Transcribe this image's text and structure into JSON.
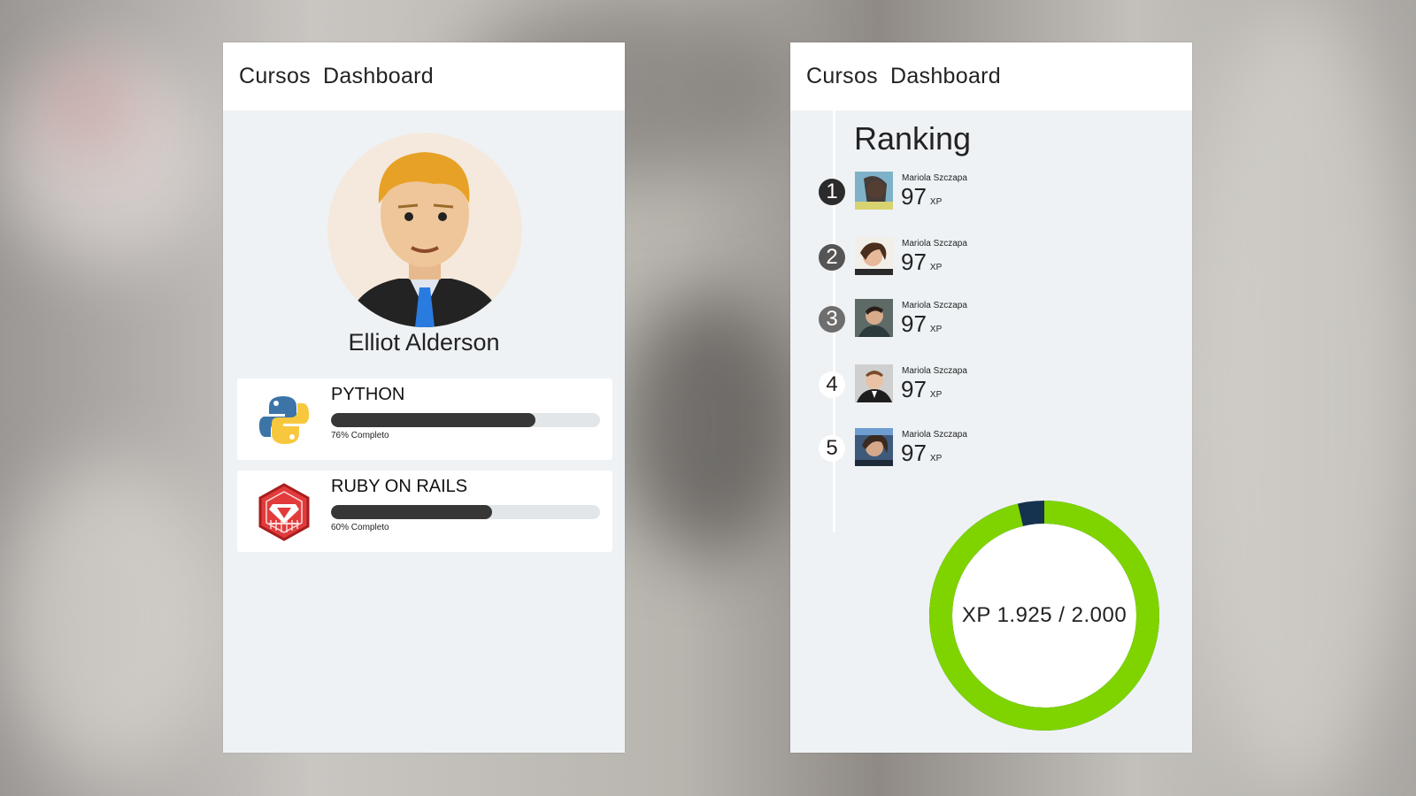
{
  "left_panel": {
    "nav": [
      "Cursos",
      "Dashboard"
    ],
    "user_name": "Elliot Alderson",
    "courses": [
      {
        "title": "PYTHON",
        "progress": 0.76,
        "label": "76% Completo",
        "icon": "python-logo-icon"
      },
      {
        "title": "RUBY ON RAILS",
        "progress": 0.6,
        "label": "60% Completo",
        "icon": "ruby-gem-icon"
      }
    ]
  },
  "right_panel": {
    "nav": [
      "Cursos",
      "Dashboard"
    ],
    "ranking_title": "Ranking",
    "ranking": [
      {
        "rank": "1",
        "name": "Mariola Szczapa",
        "xp": "97",
        "xp_unit": "XP"
      },
      {
        "rank": "2",
        "name": "Mariola Szczapa",
        "xp": "97",
        "xp_unit": "XP"
      },
      {
        "rank": "3",
        "name": "Mariola Szczapa",
        "xp": "97",
        "xp_unit": "XP"
      },
      {
        "rank": "4",
        "name": "Mariola Szczapa",
        "xp": "97",
        "xp_unit": "XP"
      },
      {
        "rank": "5",
        "name": "Mariola Szczapa",
        "xp": "97",
        "xp_unit": "XP"
      }
    ],
    "xp_label": "XP 1.925 / 2.000",
    "xp_current": 1925,
    "xp_total": 2000
  },
  "colors": {
    "progress_fill": "#373737",
    "donut_primary": "#7fd400",
    "donut_secondary": "#15324f",
    "rank_badges": [
      "#2b2b2b",
      "#555555",
      "#6e6e6e",
      "#ffffff",
      "#ffffff"
    ]
  }
}
